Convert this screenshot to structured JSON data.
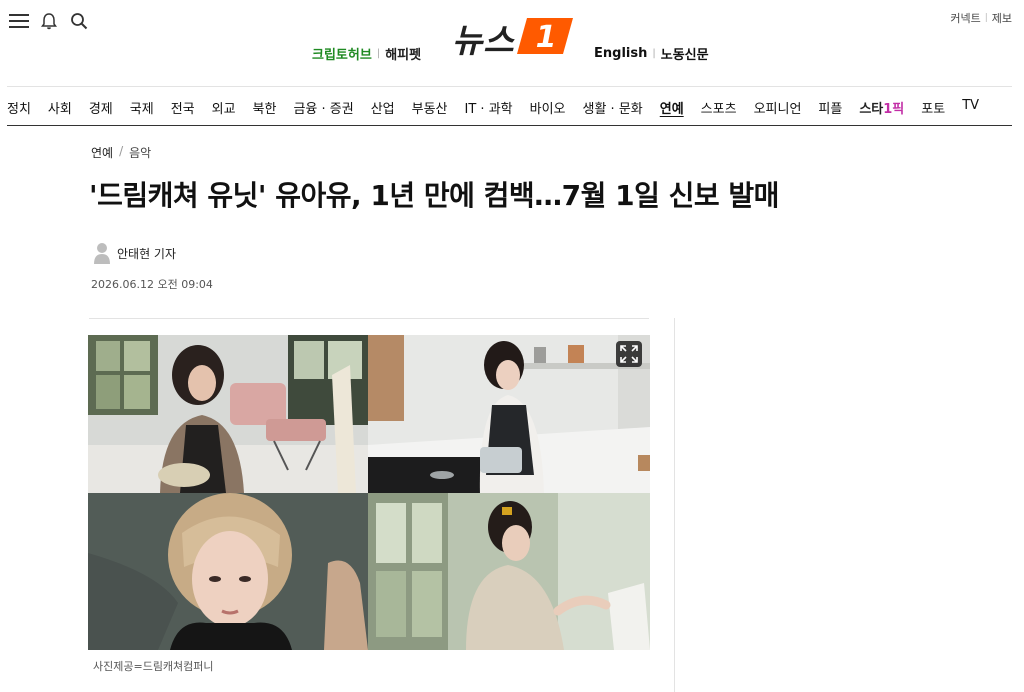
{
  "header": {
    "icons": [
      "menu-icon",
      "bell-icon",
      "search-icon"
    ],
    "right_links": [
      "커넥트",
      "제보"
    ],
    "promo_left": [
      "크립토허브",
      "해피펫"
    ],
    "logo": {
      "text": "뉴스",
      "badge": "1"
    },
    "promo_right": [
      "English",
      "노동신문"
    ]
  },
  "nav": {
    "items": [
      "정치",
      "사회",
      "경제",
      "국제",
      "전국",
      "외교",
      "북한",
      "금융 · 증권",
      "산업",
      "부동산",
      "IT · 과학",
      "바이오",
      "생활 · 문화",
      "연예",
      "스포츠",
      "오피니언",
      "피플",
      "스타1픽",
      "포토",
      "TV"
    ],
    "active": "연예",
    "star_item": {
      "prefix": "스타",
      "highlight": "1픽"
    }
  },
  "article": {
    "breadcrumb": [
      "연예",
      "음악"
    ],
    "headline": "'드림캐쳐 유닛' 유아유, 1년 만에 컴백…7월 1일 신보 발매",
    "author": "안태현 기자",
    "date": "2026.06.12 오전 09:04",
    "caption": "사진제공=드림캐쳐컴퍼니"
  },
  "colors": {
    "accent": "#ff5a00",
    "green": "#1f8a22",
    "star": "#c22ea6"
  }
}
